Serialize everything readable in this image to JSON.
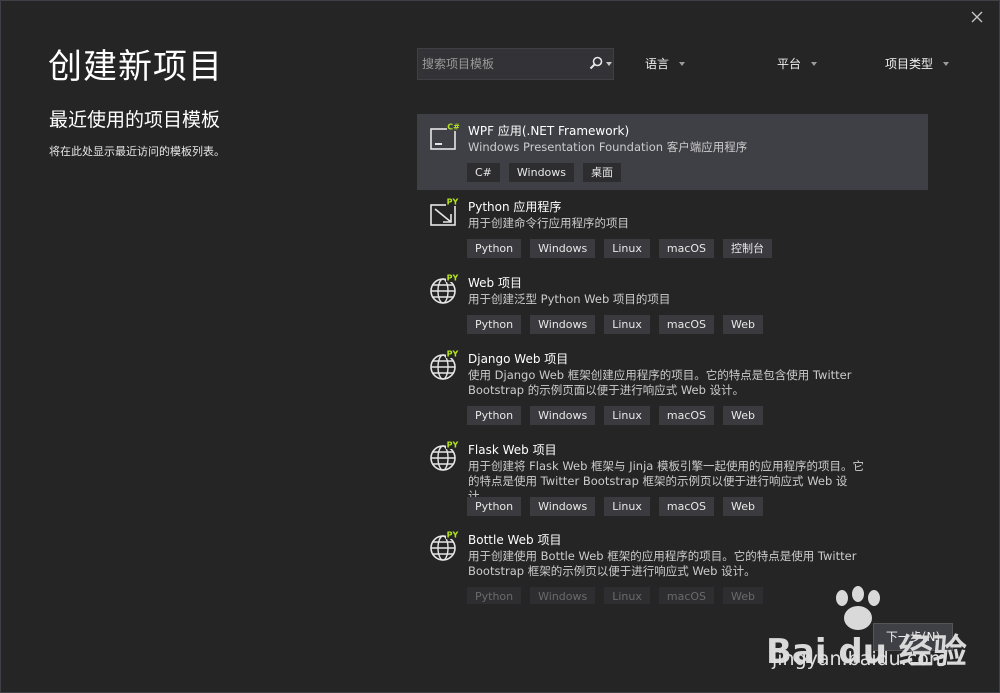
{
  "title": "创建新项目",
  "recent": {
    "heading": "最近使用的项目模板",
    "description": "将在此处显示最近访问的模板列表。"
  },
  "search": {
    "placeholder": "搜索项目模板"
  },
  "filters": {
    "language": "语言",
    "platform": "平台",
    "project_type": "项目类型"
  },
  "templates": [
    {
      "name": "WPF 应用(.NET Framework)",
      "description": "Windows Presentation Foundation 客户端应用程序",
      "tags": [
        "C#",
        "Windows",
        "桌面"
      ],
      "icon": "wpf-icon",
      "lang_badge": "C#",
      "selected": true
    },
    {
      "name": "Python 应用程序",
      "description": "用于创建命令行应用程序的项目",
      "tags": [
        "Python",
        "Windows",
        "Linux",
        "macOS",
        "控制台"
      ],
      "icon": "python-app-icon",
      "lang_badge": "PY"
    },
    {
      "name": "Web 项目",
      "description": "用于创建泛型 Python Web 项目的项目",
      "tags": [
        "Python",
        "Windows",
        "Linux",
        "macOS",
        "Web"
      ],
      "icon": "globe-icon",
      "lang_badge": "PY"
    },
    {
      "name": "Django Web 项目",
      "description": "使用 Django Web 框架创建应用程序的项目。它的特点是包含使用 Twitter Bootstrap 的示例页面以便于进行响应式 Web 设计。",
      "tags": [
        "Python",
        "Windows",
        "Linux",
        "macOS",
        "Web"
      ],
      "icon": "globe-icon",
      "lang_badge": "PY"
    },
    {
      "name": "Flask Web 项目",
      "description": "用于创建将 Flask Web 框架与 Jinja 模板引擎一起使用的应用程序的项目。它的特点是使用 Twitter Bootstrap 框架的示例页以便于进行响应式 Web 设计。",
      "tags": [
        "Python",
        "Windows",
        "Linux",
        "macOS",
        "Web"
      ],
      "icon": "globe-icon",
      "lang_badge": "PY"
    },
    {
      "name": "Bottle Web 项目",
      "description": "用于创建使用 Bottle Web 框架的应用程序的项目。它的特点是使用 Twitter Bootstrap 框架的示例页以便于进行响应式 Web 设计。",
      "tags": [
        "Python",
        "Windows",
        "Linux",
        "macOS",
        "Web"
      ],
      "icon": "globe-icon",
      "lang_badge": "PY"
    }
  ],
  "next_button": "下一步(N)",
  "watermark": {
    "logo_text": "Bai du 经验",
    "url": "jingyan.baidu.com"
  },
  "colors": {
    "background": "#252526",
    "selected_row": "#3f3f46",
    "tag_bg": "#3a3a3f",
    "badge_green": "#b5e61d"
  }
}
